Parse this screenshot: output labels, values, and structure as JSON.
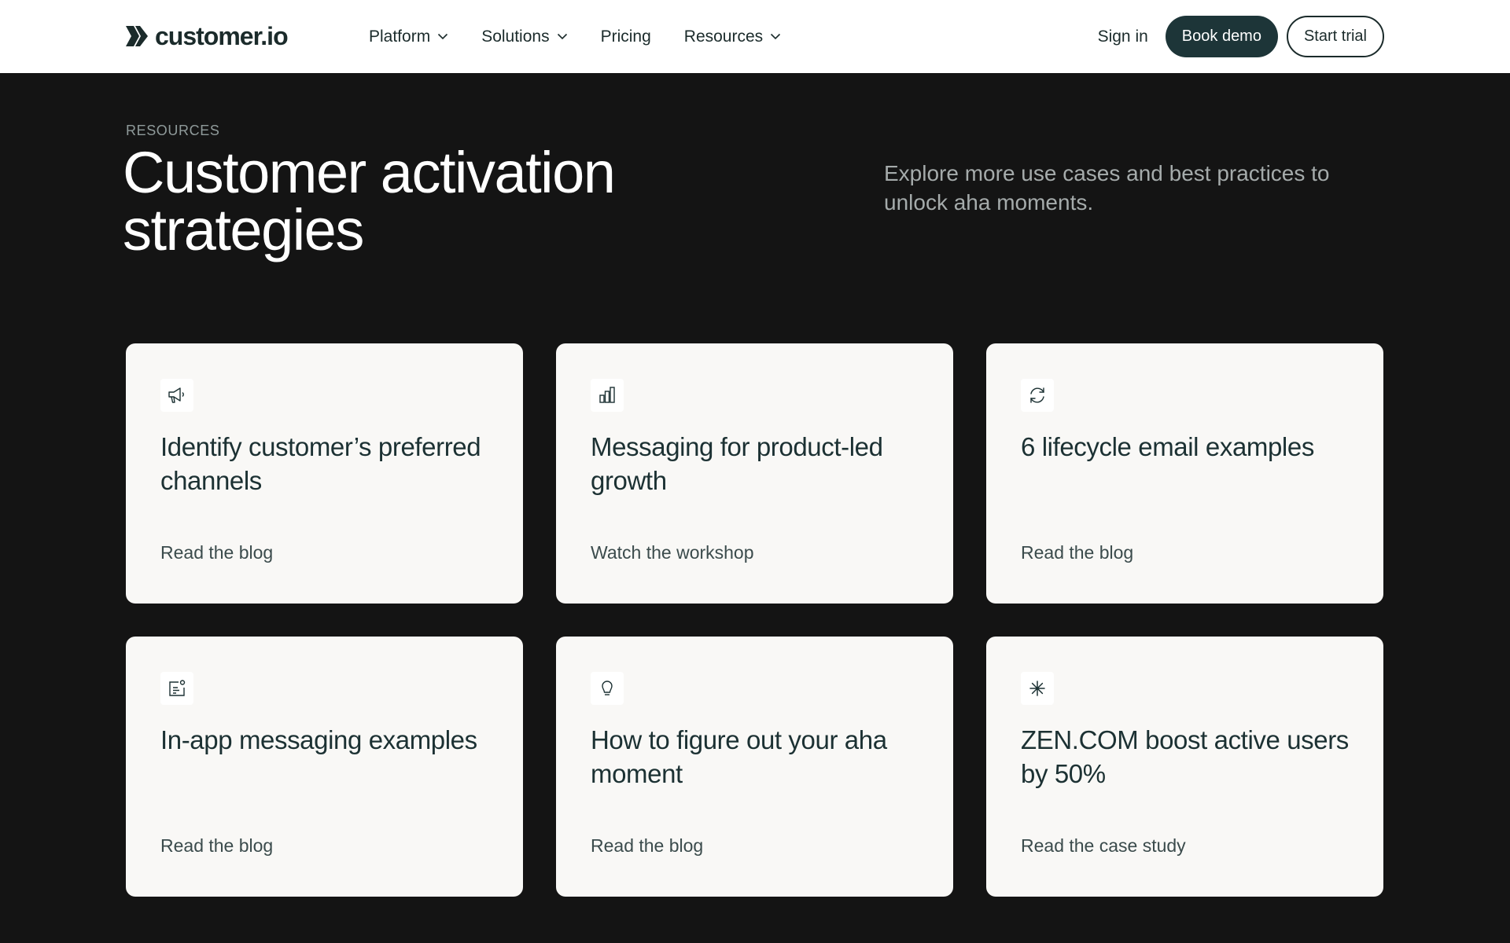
{
  "header": {
    "logo_text": "customer.io",
    "nav": [
      {
        "label": "Platform",
        "dropdown": true
      },
      {
        "label": "Solutions",
        "dropdown": true
      },
      {
        "label": "Pricing",
        "dropdown": false
      },
      {
        "label": "Resources",
        "dropdown": true
      }
    ],
    "sign_in": "Sign in",
    "book_demo": "Book demo",
    "start_trial": "Start trial"
  },
  "hero": {
    "eyebrow": "RESOURCES",
    "title_line1": "Customer activation",
    "title_line2": "strategies",
    "subtitle": "Explore more use cases and best practices to unlock aha moments."
  },
  "cards": [
    {
      "icon": "megaphone-icon",
      "title": "Identify customer’s preferred channels",
      "link": "Read the blog"
    },
    {
      "icon": "bar-chart-icon",
      "title": "Messaging for product-led growth",
      "link": "Watch the workshop"
    },
    {
      "icon": "refresh-icon",
      "title": "6 lifecycle email examples",
      "link": "Read the blog"
    },
    {
      "icon": "in-app-message-icon",
      "title": "In-app messaging examples",
      "link": "Read the blog"
    },
    {
      "icon": "lightbulb-icon",
      "title": "How to figure out your aha moment",
      "link": "Read the blog"
    },
    {
      "icon": "sparkle-icon",
      "title": "ZEN.COM boost active users by 50%",
      "link": "Read the case study"
    }
  ],
  "colors": {
    "page_background": "#141414",
    "header_background": "#ffffff",
    "card_background": "#f9f8f6",
    "primary_button": "#1d3538",
    "heading_text": "#1c3133"
  }
}
